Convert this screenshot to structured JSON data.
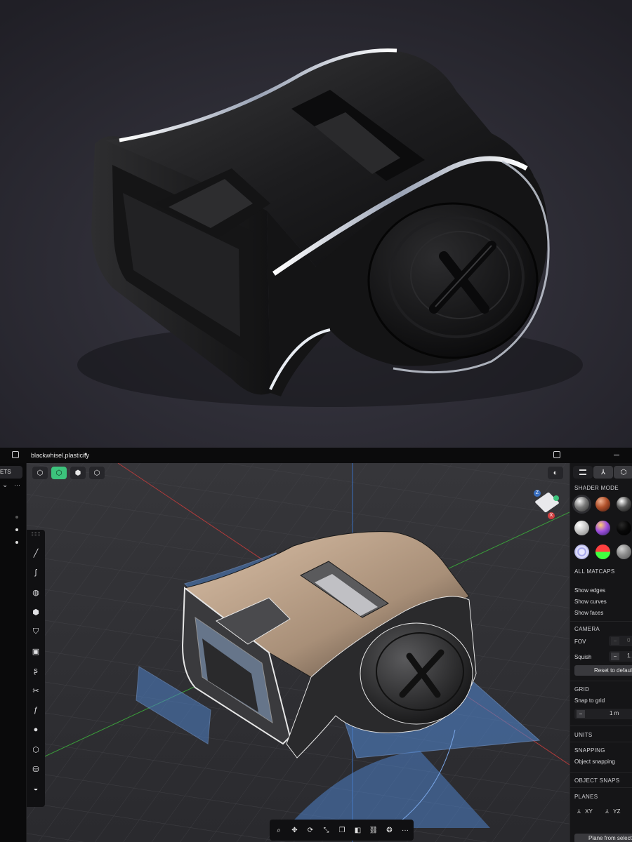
{
  "window": {
    "filename": "blackwhisel.plasticity",
    "modified_dot": "●",
    "left_tab_fragment": "ETS",
    "more": "···",
    "collapse_chevron": "⌄"
  },
  "viewport_toolbar": {
    "modes": [
      {
        "name": "vertex-select-mode",
        "glyph": "⬡",
        "active": false
      },
      {
        "name": "edge-select-mode",
        "glyph": "⬡",
        "active": true
      },
      {
        "name": "face-select-mode",
        "glyph": "⬢",
        "active": false
      },
      {
        "name": "solid-select-mode",
        "glyph": "⬡",
        "active": false
      }
    ],
    "xray_glyph": "◐"
  },
  "view_cube": {
    "z_label": "Z",
    "x_label": "X",
    "y_label": "Y"
  },
  "left_tools": [
    "line-tool",
    "curve-tool",
    "sphere-tool",
    "box-tool",
    "cylinder-tool",
    "select-box-tool",
    "spline-tool",
    "cut-tool",
    "fillet-tool",
    "circle-tool",
    "extrude-tool",
    "database-tool",
    "bucket-tool"
  ],
  "bottom_toolbar": [
    {
      "name": "search-icon",
      "glyph": "⌕"
    },
    {
      "name": "move-icon",
      "glyph": "✥"
    },
    {
      "name": "rotate-icon",
      "glyph": "⟳"
    },
    {
      "name": "scale-icon",
      "glyph": "⤡"
    },
    {
      "name": "duplicate-icon",
      "glyph": "❐"
    },
    {
      "name": "boolean-icon",
      "glyph": "◧"
    },
    {
      "name": "link-icon",
      "glyph": "⛓"
    },
    {
      "name": "group-icon",
      "glyph": "❂"
    },
    {
      "name": "more-icon",
      "glyph": "···"
    }
  ],
  "right_panel": {
    "tabs": [
      "layers-tab",
      "orientation-tab",
      "render-tab"
    ],
    "shader_mode": {
      "title": "SHADER MODE",
      "swatches": [
        {
          "name": "matcap-gray-glossy",
          "colors": [
            "#f2f2f2",
            "#7a7a7a",
            "#2a2a2a"
          ],
          "selected": true
        },
        {
          "name": "matcap-copper",
          "colors": [
            "#f0b090",
            "#b0502a",
            "#401810"
          ],
          "selected": false
        },
        {
          "name": "matcap-chrome",
          "colors": [
            "#ffffff",
            "#555555",
            "#111111"
          ],
          "selected": false
        },
        {
          "name": "matcap-white",
          "colors": [
            "#ffffff",
            "#c8c8c8",
            "#7a7a7a"
          ],
          "selected": false
        },
        {
          "name": "matcap-iridescent",
          "colors": [
            "#ffd070",
            "#a050e0",
            "#302060"
          ],
          "selected": false
        },
        {
          "name": "matcap-black",
          "colors": [
            "#2a2a2a",
            "#080808",
            "#000000"
          ],
          "selected": false
        },
        {
          "name": "matcap-blue-ring",
          "colors": [
            "#e8e8ff",
            "#9a9ae8",
            "#5050b0"
          ],
          "selected": false
        },
        {
          "name": "matcap-normal",
          "colors": [
            "#ff4040",
            "#40ff40",
            "#2020ff"
          ],
          "selected": false
        },
        {
          "name": "matcap-gray-matte",
          "colors": [
            "#d0d0d0",
            "#8c8c8c",
            "#505050"
          ],
          "selected": false
        }
      ]
    },
    "all_matcaps": "ALL MATCAPS",
    "display": {
      "show_edges": "Show edges",
      "show_curves": "Show curves",
      "show_faces": "Show faces"
    },
    "camera": {
      "title": "CAMERA",
      "fov_label": "FOV",
      "fov_minus": "−",
      "fov_value": "0",
      "squish_label": "Squish",
      "squish_minus": "−",
      "squish_value": "1.",
      "reset": "Reset to default"
    },
    "grid": {
      "title": "GRID",
      "snap_label": "Snap to grid",
      "minus": "−",
      "value": "1 m"
    },
    "units": {
      "title": "UNITS"
    },
    "snapping": {
      "title": "SNAPPING",
      "object_snapping": "Object snapping"
    },
    "object_snaps": {
      "title": "OBJECT SNAPS"
    },
    "planes": {
      "title": "PLANES",
      "xy": "XY",
      "yz": "YZ",
      "from_selection": "Plane from select"
    }
  }
}
